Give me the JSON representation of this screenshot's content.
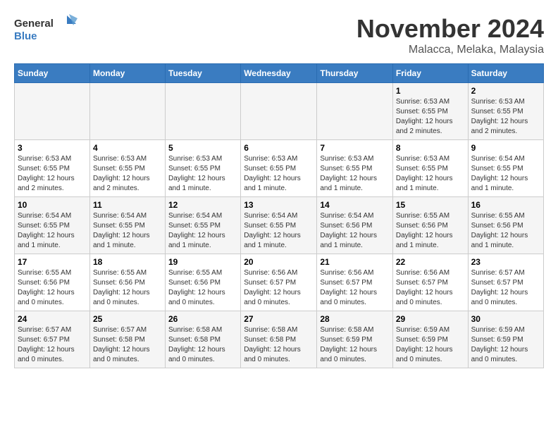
{
  "logo": {
    "line1": "General",
    "line2": "Blue"
  },
  "title": "November 2024",
  "subtitle": "Malacca, Melaka, Malaysia",
  "weekdays": [
    "Sunday",
    "Monday",
    "Tuesday",
    "Wednesday",
    "Thursday",
    "Friday",
    "Saturday"
  ],
  "weeks": [
    [
      {
        "day": "",
        "info": ""
      },
      {
        "day": "",
        "info": ""
      },
      {
        "day": "",
        "info": ""
      },
      {
        "day": "",
        "info": ""
      },
      {
        "day": "",
        "info": ""
      },
      {
        "day": "1",
        "info": "Sunrise: 6:53 AM\nSunset: 6:55 PM\nDaylight: 12 hours and 2 minutes."
      },
      {
        "day": "2",
        "info": "Sunrise: 6:53 AM\nSunset: 6:55 PM\nDaylight: 12 hours and 2 minutes."
      }
    ],
    [
      {
        "day": "3",
        "info": "Sunrise: 6:53 AM\nSunset: 6:55 PM\nDaylight: 12 hours and 2 minutes."
      },
      {
        "day": "4",
        "info": "Sunrise: 6:53 AM\nSunset: 6:55 PM\nDaylight: 12 hours and 2 minutes."
      },
      {
        "day": "5",
        "info": "Sunrise: 6:53 AM\nSunset: 6:55 PM\nDaylight: 12 hours and 1 minute."
      },
      {
        "day": "6",
        "info": "Sunrise: 6:53 AM\nSunset: 6:55 PM\nDaylight: 12 hours and 1 minute."
      },
      {
        "day": "7",
        "info": "Sunrise: 6:53 AM\nSunset: 6:55 PM\nDaylight: 12 hours and 1 minute."
      },
      {
        "day": "8",
        "info": "Sunrise: 6:53 AM\nSunset: 6:55 PM\nDaylight: 12 hours and 1 minute."
      },
      {
        "day": "9",
        "info": "Sunrise: 6:54 AM\nSunset: 6:55 PM\nDaylight: 12 hours and 1 minute."
      }
    ],
    [
      {
        "day": "10",
        "info": "Sunrise: 6:54 AM\nSunset: 6:55 PM\nDaylight: 12 hours and 1 minute."
      },
      {
        "day": "11",
        "info": "Sunrise: 6:54 AM\nSunset: 6:55 PM\nDaylight: 12 hours and 1 minute."
      },
      {
        "day": "12",
        "info": "Sunrise: 6:54 AM\nSunset: 6:55 PM\nDaylight: 12 hours and 1 minute."
      },
      {
        "day": "13",
        "info": "Sunrise: 6:54 AM\nSunset: 6:55 PM\nDaylight: 12 hours and 1 minute."
      },
      {
        "day": "14",
        "info": "Sunrise: 6:54 AM\nSunset: 6:56 PM\nDaylight: 12 hours and 1 minute."
      },
      {
        "day": "15",
        "info": "Sunrise: 6:55 AM\nSunset: 6:56 PM\nDaylight: 12 hours and 1 minute."
      },
      {
        "day": "16",
        "info": "Sunrise: 6:55 AM\nSunset: 6:56 PM\nDaylight: 12 hours and 1 minute."
      }
    ],
    [
      {
        "day": "17",
        "info": "Sunrise: 6:55 AM\nSunset: 6:56 PM\nDaylight: 12 hours and 0 minutes."
      },
      {
        "day": "18",
        "info": "Sunrise: 6:55 AM\nSunset: 6:56 PM\nDaylight: 12 hours and 0 minutes."
      },
      {
        "day": "19",
        "info": "Sunrise: 6:55 AM\nSunset: 6:56 PM\nDaylight: 12 hours and 0 minutes."
      },
      {
        "day": "20",
        "info": "Sunrise: 6:56 AM\nSunset: 6:57 PM\nDaylight: 12 hours and 0 minutes."
      },
      {
        "day": "21",
        "info": "Sunrise: 6:56 AM\nSunset: 6:57 PM\nDaylight: 12 hours and 0 minutes."
      },
      {
        "day": "22",
        "info": "Sunrise: 6:56 AM\nSunset: 6:57 PM\nDaylight: 12 hours and 0 minutes."
      },
      {
        "day": "23",
        "info": "Sunrise: 6:57 AM\nSunset: 6:57 PM\nDaylight: 12 hours and 0 minutes."
      }
    ],
    [
      {
        "day": "24",
        "info": "Sunrise: 6:57 AM\nSunset: 6:57 PM\nDaylight: 12 hours and 0 minutes."
      },
      {
        "day": "25",
        "info": "Sunrise: 6:57 AM\nSunset: 6:58 PM\nDaylight: 12 hours and 0 minutes."
      },
      {
        "day": "26",
        "info": "Sunrise: 6:58 AM\nSunset: 6:58 PM\nDaylight: 12 hours and 0 minutes."
      },
      {
        "day": "27",
        "info": "Sunrise: 6:58 AM\nSunset: 6:58 PM\nDaylight: 12 hours and 0 minutes."
      },
      {
        "day": "28",
        "info": "Sunrise: 6:58 AM\nSunset: 6:59 PM\nDaylight: 12 hours and 0 minutes."
      },
      {
        "day": "29",
        "info": "Sunrise: 6:59 AM\nSunset: 6:59 PM\nDaylight: 12 hours and 0 minutes."
      },
      {
        "day": "30",
        "info": "Sunrise: 6:59 AM\nSunset: 6:59 PM\nDaylight: 12 hours and 0 minutes."
      }
    ]
  ]
}
